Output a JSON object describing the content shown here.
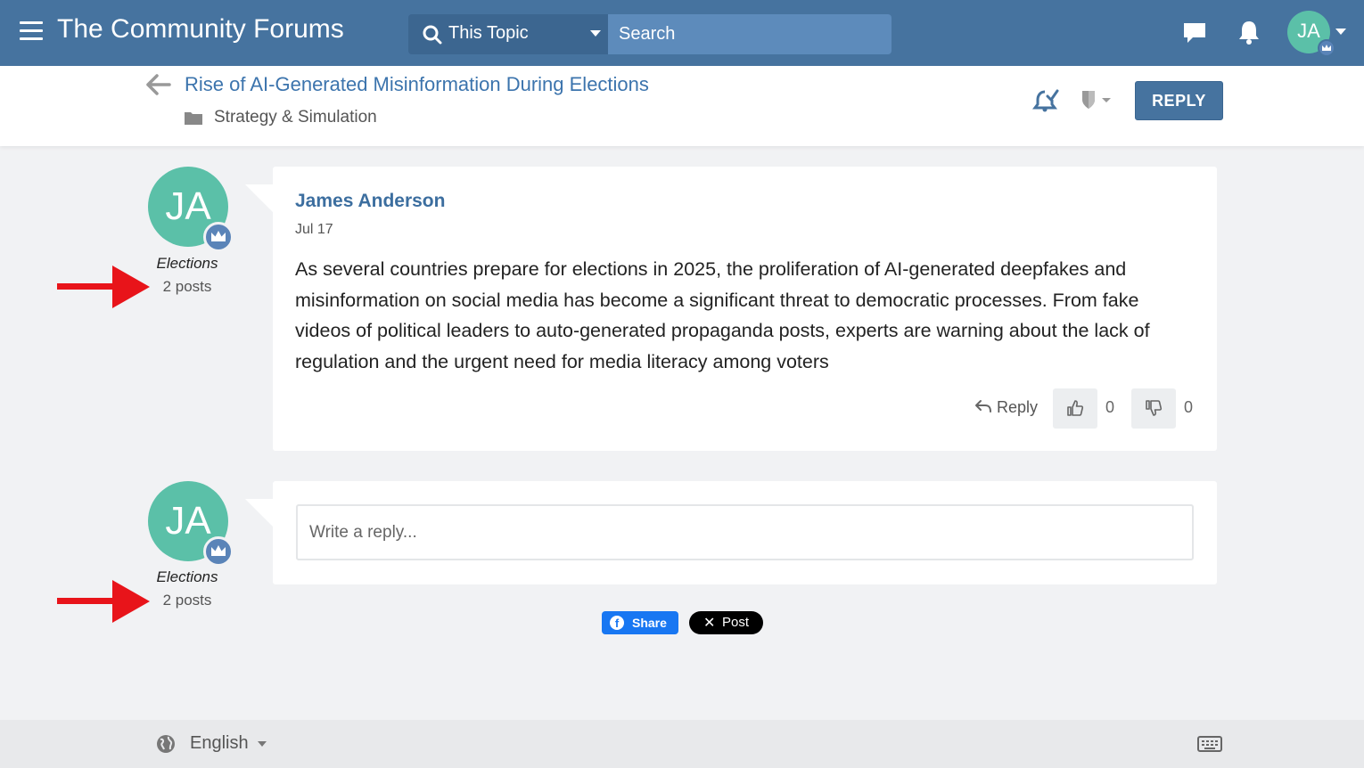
{
  "header": {
    "site_title": "The Community Forums",
    "search_scope": "This Topic",
    "search_placeholder": "Search",
    "user_initials": "JA",
    "brand_color": "#46739f"
  },
  "topic": {
    "title": "Rise of AI-Generated Misinformation During Elections",
    "category": "Strategy & Simulation",
    "reply_button": "REPLY"
  },
  "post": {
    "author": "James Anderson",
    "initials": "JA",
    "group": "Elections",
    "post_count": "2 posts",
    "date": "Jul 17",
    "body": "As several countries prepare for elections in 2025, the proliferation of AI-generated deepfakes and misinformation on social media has become a significant threat to democratic processes. From fake videos of political leaders to auto-generated propaganda posts, experts are warning about the lack of regulation and the urgent need for media literacy among voters",
    "reply_label": "Reply",
    "upvotes": "0",
    "downvotes": "0"
  },
  "composer": {
    "initials": "JA",
    "group": "Elections",
    "post_count": "2 posts",
    "placeholder": "Write a reply..."
  },
  "share": {
    "facebook_label": "Share",
    "x_label": "Post"
  },
  "footer": {
    "language": "English"
  },
  "icons": [
    "hamburger-icon",
    "search-icon",
    "chat-icon",
    "bell-icon",
    "crown-icon",
    "back-arrow-icon",
    "folder-icon",
    "watch-icon",
    "shield-icon",
    "reply-arrow-icon",
    "thumbs-up-icon",
    "thumbs-down-icon",
    "facebook-icon",
    "x-icon",
    "globe-icon",
    "keyboard-icon",
    "red-arrow-icon"
  ]
}
